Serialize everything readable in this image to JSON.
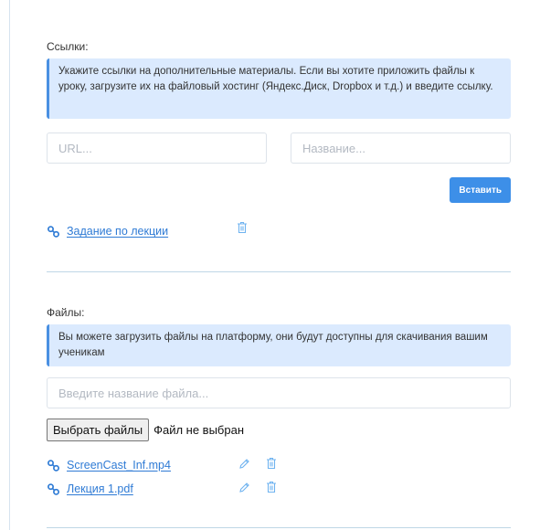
{
  "links": {
    "label": "Ссылки:",
    "info": "Укажите ссылки на дополнительные материалы. Если вы хотите приложить файлы к уроку, загрузите их на файловый хостинг (Яндекс.Диск, Dropbox и т.д.) и введите ссылку.",
    "url_placeholder": "URL...",
    "name_placeholder": "Название...",
    "insert_label": "Вставить",
    "items": [
      {
        "title": "Задание по лекции"
      }
    ]
  },
  "files": {
    "label": "Файлы:",
    "info": "Вы можете загрузить файлы на платформу, они будут доступны для скачивания вашим ученикам",
    "name_placeholder": "Введите название файла...",
    "choose_label": "Выбрать файлы",
    "status": "Файл не выбран",
    "items": [
      {
        "title": "ScreenCast_Inf.mp4"
      },
      {
        "title": "Лекция 1.pdf"
      }
    ]
  },
  "colors": {
    "accent": "#3d8fe8",
    "link": "#2f7bd5",
    "info_bg": "#dbeafe",
    "icon": "#6fb3f0"
  },
  "icons": {
    "link": "link-chain-icon",
    "edit": "pencil-icon",
    "delete": "trash-icon"
  }
}
